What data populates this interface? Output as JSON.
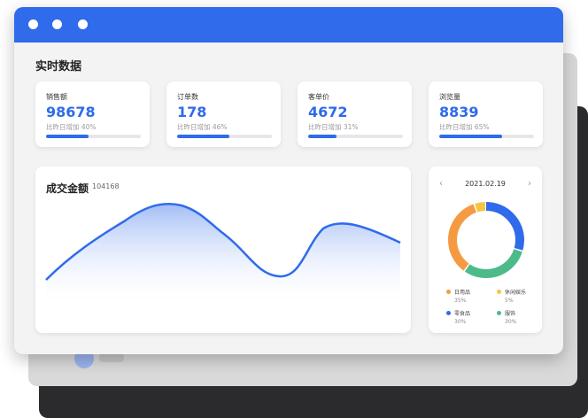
{
  "section_title": "实时数据",
  "stats": [
    {
      "label": "销售额",
      "value": "98678",
      "compare": "比昨日增加 40%",
      "progress": 0.45
    },
    {
      "label": "订单数",
      "value": "178",
      "compare": "比昨日增加 46%",
      "progress": 0.55
    },
    {
      "label": "客单价",
      "value": "4672",
      "compare": "比昨日增加 31%",
      "progress": 0.3
    },
    {
      "label": "浏览量",
      "value": "8839",
      "compare": "比昨日增加 65%",
      "progress": 0.66
    }
  ],
  "chart": {
    "title": "成交金额",
    "total": "104168",
    "line_color": "#2f6bea"
  },
  "donut": {
    "date": "2021.02.19",
    "prev_icon": "chevron-left-icon",
    "next_icon": "chevron-right-icon",
    "segments": [
      {
        "name": "日用品",
        "percent": "35%",
        "value": 35,
        "color": "#f59a42"
      },
      {
        "name": "休闲娱乐",
        "percent": "5%",
        "value": 5,
        "color": "#f5c542"
      },
      {
        "name": "零食品",
        "percent": "30%",
        "value": 30,
        "color": "#2f6bea"
      },
      {
        "name": "服饰",
        "percent": "30%",
        "value": 30,
        "color": "#4dba8a"
      }
    ]
  },
  "colors": {
    "accent": "#2f6bea",
    "titlebar": "#2f6bea"
  }
}
